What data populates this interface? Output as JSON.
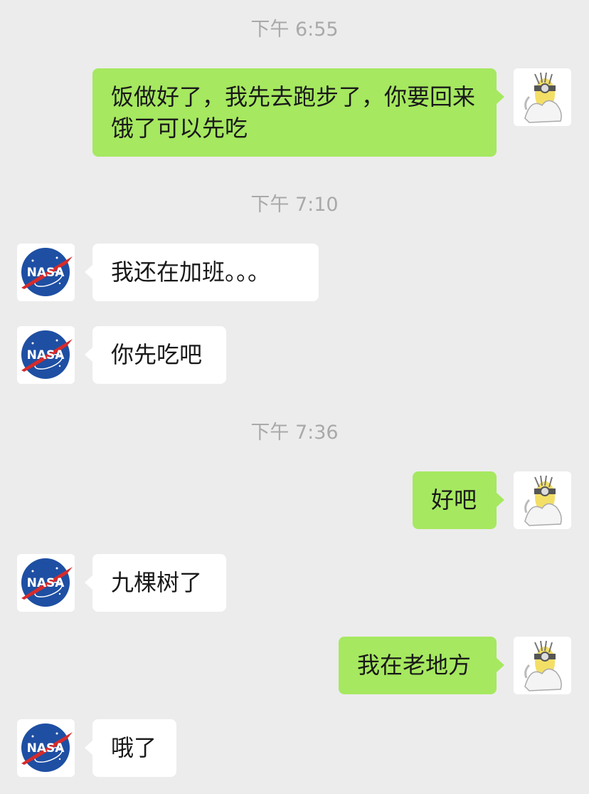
{
  "colors": {
    "background": "#ececec",
    "outgoing_bubble": "#a6e860",
    "incoming_bubble": "#ffffff",
    "timestamp_text": "#a9a9a9"
  },
  "avatars": {
    "self": "minion-avatar-icon",
    "contact": "nasa-logo-icon"
  },
  "contact_logo_text": "NASA",
  "timestamps": [
    "下午 6:55",
    "下午 7:10",
    "下午 7:36"
  ],
  "messages": [
    {
      "direction": "outgoing",
      "text": "饭做好了，我先去跑步了，你要回来饿了可以先吃"
    },
    {
      "direction": "incoming",
      "text": "我还在加班。。。"
    },
    {
      "direction": "incoming",
      "text": "你先吃吧"
    },
    {
      "direction": "outgoing",
      "text": "好吧"
    },
    {
      "direction": "incoming",
      "text": "九棵树了"
    },
    {
      "direction": "outgoing",
      "text": "我在老地方"
    },
    {
      "direction": "incoming",
      "text": "哦了"
    }
  ]
}
